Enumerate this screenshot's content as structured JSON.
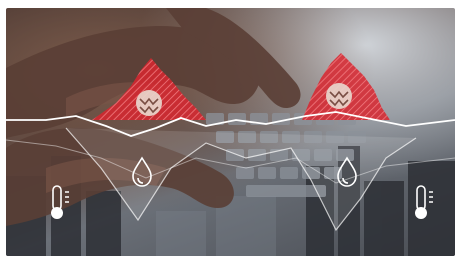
{
  "scene": {
    "description_free": true,
    "icons": [
      {
        "name": "thermometer-icon",
        "side": "left"
      },
      {
        "name": "water-drop-icon",
        "side": "left"
      },
      {
        "name": "water-drop-icon",
        "side": "right"
      },
      {
        "name": "thermometer-icon",
        "side": "right"
      },
      {
        "name": "fluctuation-badge-icon",
        "side": "left"
      },
      {
        "name": "fluctuation-badge-icon",
        "side": "right"
      }
    ],
    "colors": {
      "accent_red": "#d8262f",
      "line_white": "#ffffff",
      "badge_fill": "#e8d6cc"
    }
  }
}
